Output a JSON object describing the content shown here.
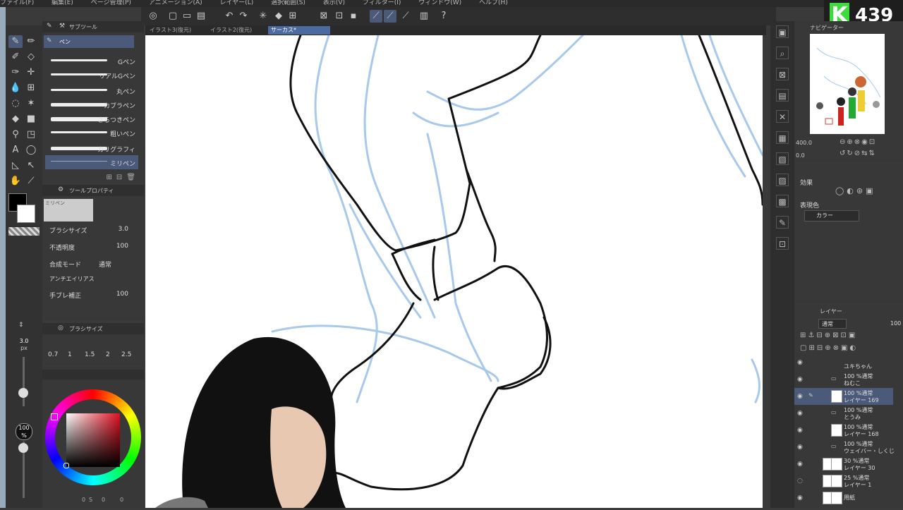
{
  "menu": [
    "ファイル(F)",
    "編集(E)",
    "ページ管理(P)",
    "アニメーション(A)",
    "レイヤー(L)",
    "選択範囲(S)",
    "表示(V)",
    "フィルター(I)",
    "ウィンドウ(W)",
    "ヘルプ(H)"
  ],
  "tabs": [
    {
      "label": "イラスト3(復元)",
      "active": false
    },
    {
      "label": "イラスト2(復元)",
      "active": false
    },
    {
      "label": "サーカス*",
      "active": true
    }
  ],
  "subtool": {
    "header": "サブツール",
    "group": "ペン",
    "brushes": [
      "Gペン",
      "リアルGペン",
      "丸ペン",
      "カブラペン",
      "さらつきペン",
      "粗いペン",
      "カリグラフィ",
      "ミリペン"
    ],
    "selected": "ミリペン"
  },
  "toolprop": {
    "header": "ツールプロパティ",
    "preview_label": "ミリペン",
    "brush_size_label": "ブラシサイズ",
    "brush_size_value": "3.0",
    "opacity_label": "不透明度",
    "opacity_value": "100",
    "blend_label": "合成モード",
    "blend_value": "通常",
    "antialias_label": "アンチエイリアス",
    "stabilize_label": "手ブレ補正",
    "stabilize_value": "100"
  },
  "brushsize_panel": {
    "header": "ブラシサイズ",
    "presets": [
      "0.7",
      "1",
      "1.5",
      "2",
      "2.5"
    ]
  },
  "slider_size": {
    "value": "3.0",
    "unit": "px"
  },
  "slider_opacity": {
    "value": "100",
    "unit": "%"
  },
  "bottom_color_values": [
    "0",
    "S",
    "0",
    "0"
  ],
  "navigator": {
    "header": "ナビゲーター",
    "zoom": "400.0",
    "angle": "0.0"
  },
  "effects": {
    "label": "効果",
    "display_color_label": "表現色",
    "display_color_value": "カラー"
  },
  "layers": {
    "header": "レイヤー",
    "blend": "通常",
    "opacity": "100",
    "items": [
      {
        "line1": "",
        "line2": "ユキちゃん",
        "folder": true,
        "selected": false
      },
      {
        "line1": "100 %通常",
        "line2": "ねむこ",
        "folder": true,
        "selected": false
      },
      {
        "line1": "100 %通常",
        "line2": "レイヤー 169",
        "folder": false,
        "selected": true
      },
      {
        "line1": "100 %通常",
        "line2": "とうみ",
        "folder": true,
        "selected": false
      },
      {
        "line1": "100 %通常",
        "line2": "レイヤー 168",
        "folder": false,
        "selected": false
      },
      {
        "line1": "100 %通常",
        "line2": "ウェイバー・しくじ",
        "folder": true,
        "selected": false
      },
      {
        "line1": "30 %通常",
        "line2": "レイヤー 30",
        "folder": false,
        "selected": false
      },
      {
        "line1": "25 %通常",
        "line2": "レイヤー 1",
        "folder": false,
        "selected": false
      },
      {
        "line1": "",
        "line2": "用紙",
        "folder": false,
        "selected": false
      }
    ]
  },
  "badge": {
    "letter": "K",
    "count": "439"
  },
  "colors": {
    "accent": "#4b5a78",
    "tab_active": "#4b6aa0",
    "badge_green": "#3ddc3d",
    "sketch_blue": "#a8c8ec"
  }
}
